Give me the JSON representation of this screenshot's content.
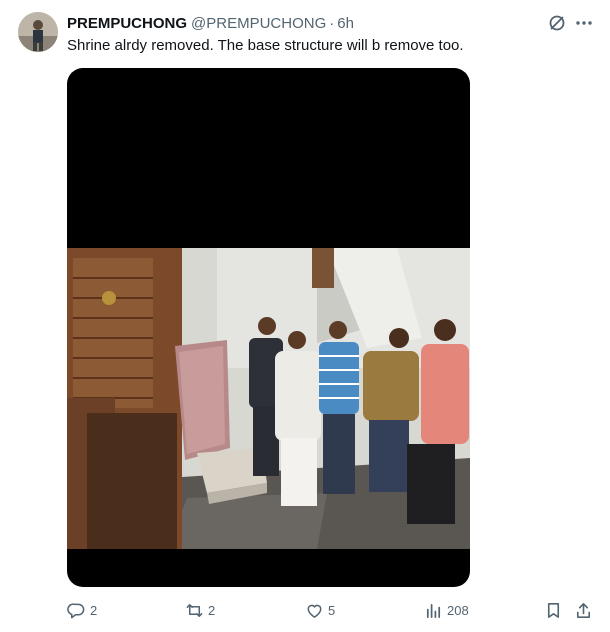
{
  "post": {
    "display_name": "PREMPUCHONG",
    "handle": "@PREMPUCHONG",
    "separator": "·",
    "time": "6h",
    "text": "Shrine alrdy removed. The base structure will b remove too."
  },
  "icons": {
    "grok": "grok-icon",
    "more": "more-icon",
    "reply": "reply-icon",
    "repost": "repost-icon",
    "like": "like-icon",
    "views": "views-icon",
    "bookmark": "bookmark-icon",
    "share": "share-icon"
  },
  "stats": {
    "replies": "2",
    "reposts": "2",
    "likes": "5",
    "views": "208"
  },
  "colors": {
    "text": "#0f1419",
    "secondary": "#536471",
    "media_bg": "#000000"
  }
}
